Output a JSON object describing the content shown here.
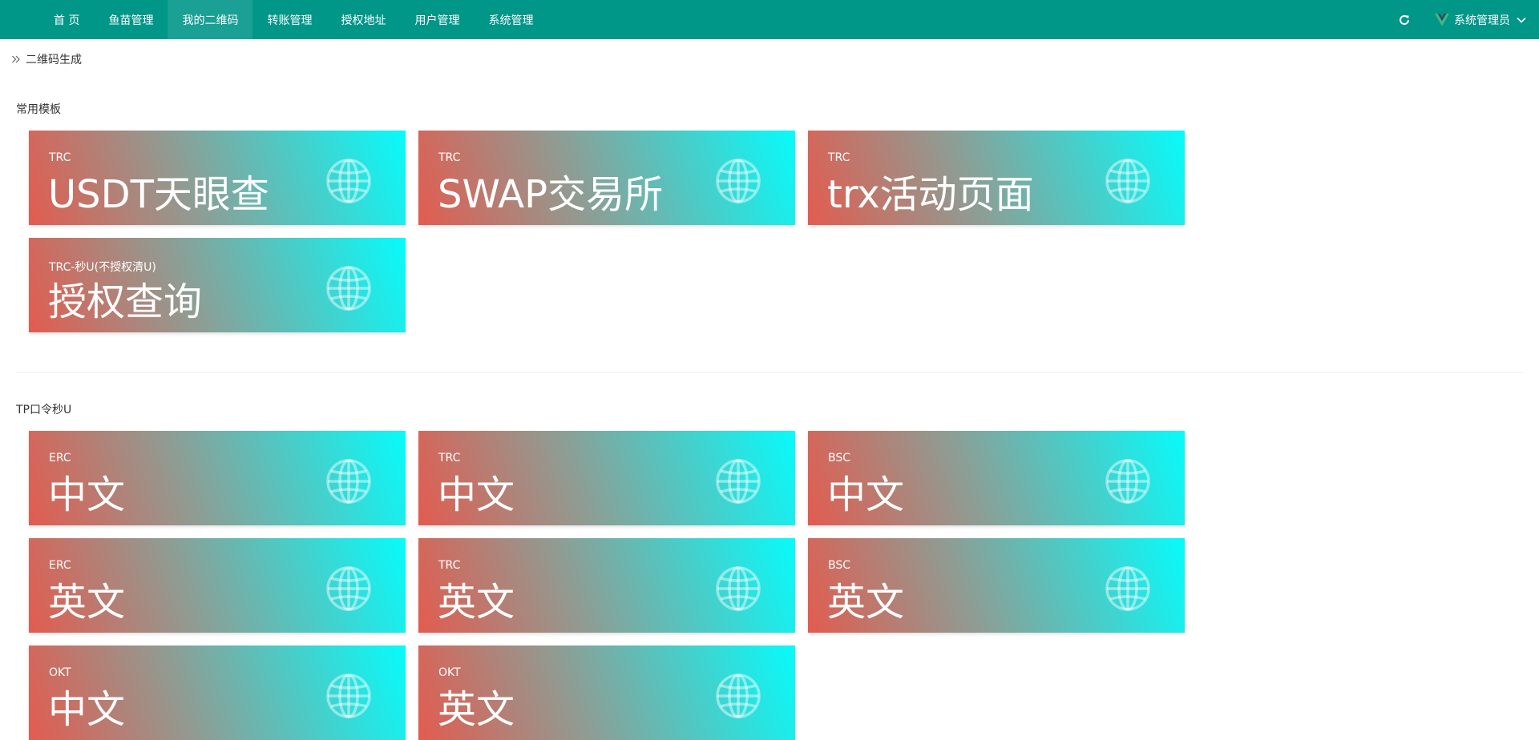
{
  "nav": {
    "items": [
      {
        "label": "首 页"
      },
      {
        "label": "鱼苗管理"
      },
      {
        "label": "我的二维码"
      },
      {
        "label": "转账管理"
      },
      {
        "label": "授权地址"
      },
      {
        "label": "用户管理"
      },
      {
        "label": "系统管理"
      }
    ],
    "active_index": 2
  },
  "user": {
    "name": "系统管理员"
  },
  "breadcrumb": {
    "label": "二维码生成"
  },
  "sections": [
    {
      "title": "常用模板",
      "cards": [
        {
          "chain": "TRC",
          "name": "USDT天眼查"
        },
        {
          "chain": "TRC",
          "name": "SWAP交易所"
        },
        {
          "chain": "TRC",
          "name": "trx活动页面"
        },
        {
          "chain": "TRC-秒U(不授权清U)",
          "name": "授权查询"
        }
      ]
    },
    {
      "title": "TP口令秒U",
      "cards": [
        {
          "chain": "ERC",
          "name": "中文"
        },
        {
          "chain": "TRC",
          "name": "中文"
        },
        {
          "chain": "BSC",
          "name": "中文"
        },
        {
          "chain": "ERC",
          "name": "英文"
        },
        {
          "chain": "TRC",
          "name": "英文"
        },
        {
          "chain": "BSC",
          "name": "英文"
        },
        {
          "chain": "OKT",
          "name": "中文"
        },
        {
          "chain": "OKT",
          "name": "英文"
        }
      ]
    }
  ],
  "colors": {
    "header": "#009688",
    "header_active": "#1aa094",
    "card_gradient_start": "#e35b4f",
    "card_gradient_end": "#07fbfb"
  },
  "icons": {
    "card": "globe-icon",
    "refresh": "refresh-icon",
    "user_logo": "vue-logo-icon",
    "breadcrumb": "double-chevron-right-icon"
  }
}
